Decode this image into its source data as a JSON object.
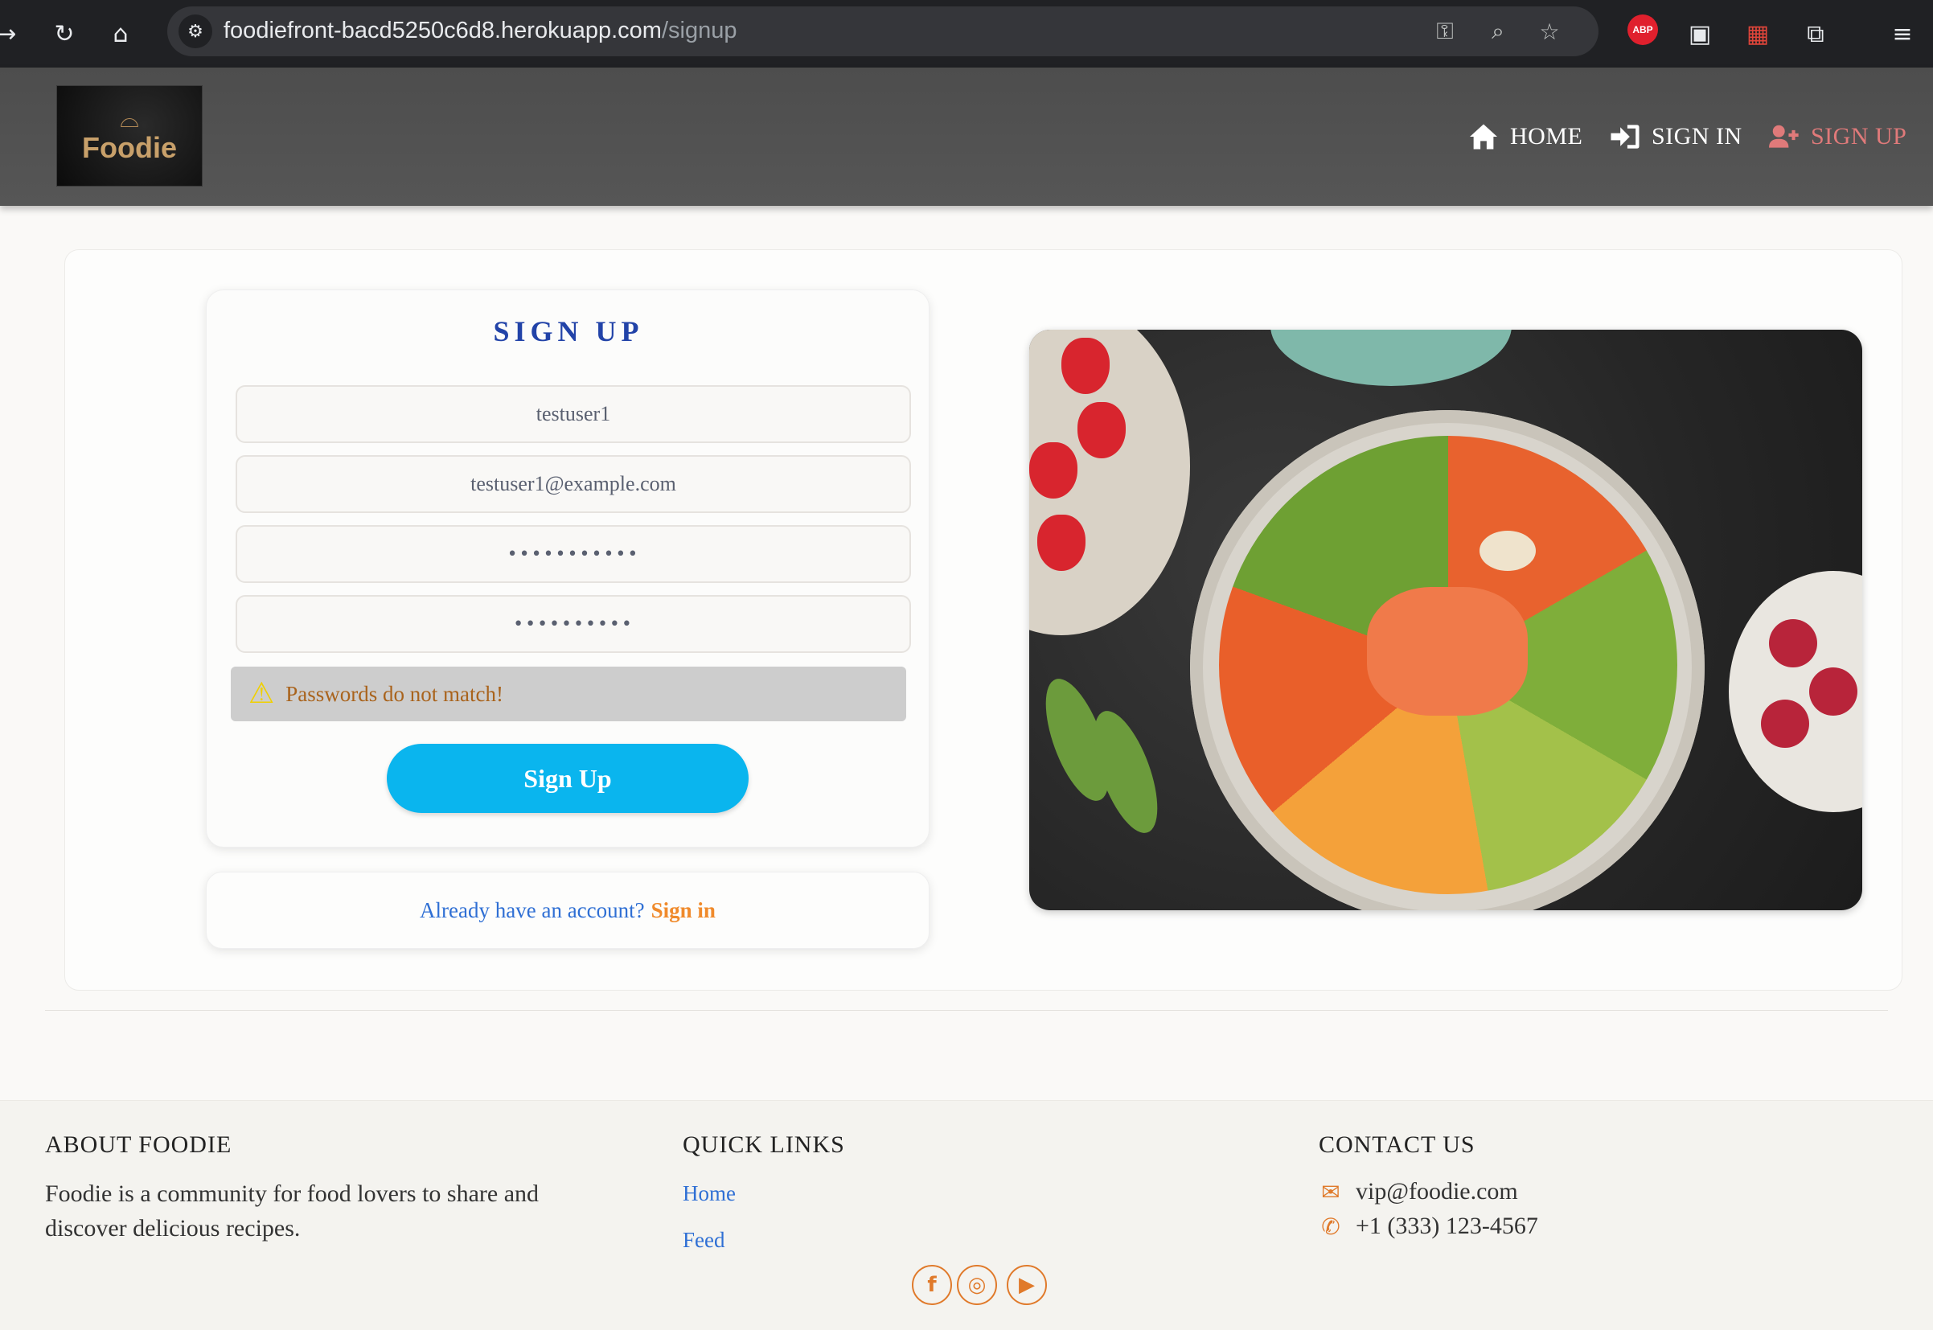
{
  "browser": {
    "url_host": "foodiefront-bacd5250c6d8.herokuapp.com",
    "url_path": "/signup",
    "abp_label": "ABP"
  },
  "navbar": {
    "logo_text": "Foodie",
    "links": [
      {
        "label": "HOME",
        "icon": "home-icon"
      },
      {
        "label": "SIGN IN",
        "icon": "sign-in-icon"
      },
      {
        "label": "SIGN UP",
        "icon": "user-plus-icon",
        "active": true
      }
    ],
    "active_color": "#e07a7a"
  },
  "signup_form": {
    "title": "SIGN UP",
    "username_value": "testuser1",
    "email_value": "testuser1@example.com",
    "password_value": "•••••••••••",
    "confirm_password_value": "••••••••••",
    "alert_message": "Passwords do not match!",
    "submit_label": "Sign Up",
    "title_color": "#2243a8",
    "button_color": "#0ab5ee"
  },
  "signin_prompt": {
    "question": "Already have an account?",
    "link_label": "Sign in"
  },
  "footer": {
    "about": {
      "title": "ABOUT FOODIE",
      "text": "Foodie is a community for food lovers to share and discover delicious recipes."
    },
    "quick_links": {
      "title": "QUICK LINKS",
      "items": [
        "Home",
        "Feed"
      ]
    },
    "contact": {
      "title": "CONTACT US",
      "email": "vip@foodie.com",
      "phone": "+1 (333) 123-4567"
    },
    "social": [
      "facebook-icon",
      "instagram-icon",
      "youtube-icon"
    ],
    "accent_color": "#e07a2b"
  }
}
